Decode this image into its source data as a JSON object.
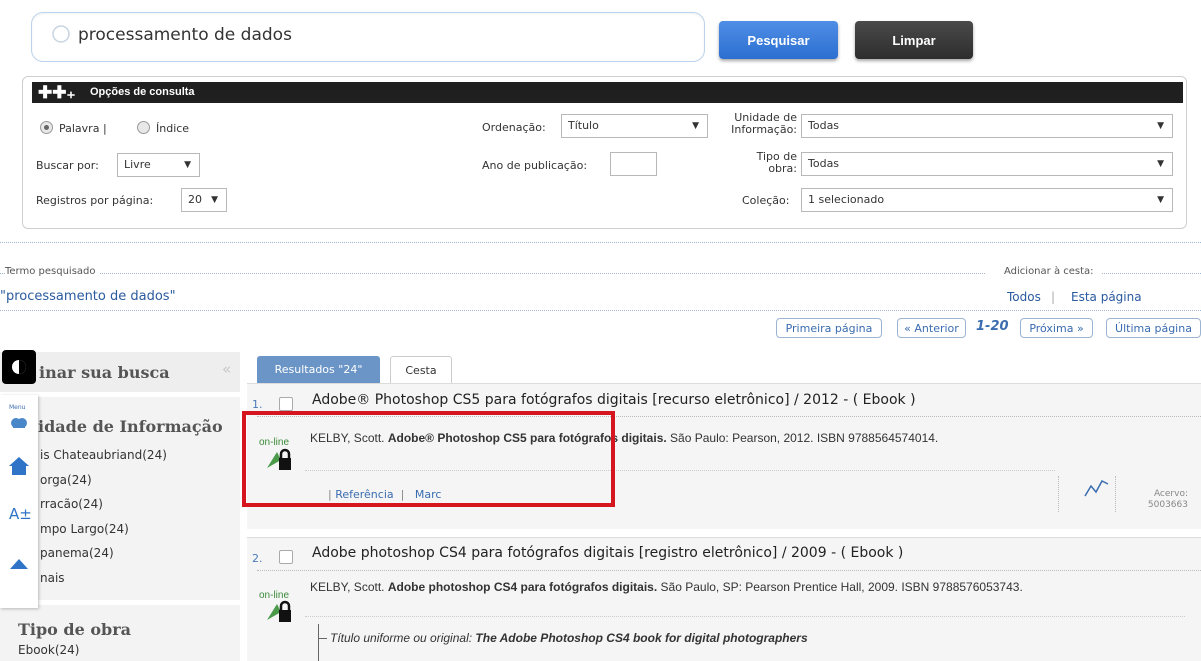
{
  "search": {
    "query": "processamento de dados",
    "search_label": "Pesquisar",
    "clear_label": "Limpar"
  },
  "options": {
    "header": "Opções de consulta",
    "radio_word": "Palavra |",
    "radio_index": "Índice",
    "search_by_label": "Buscar por:",
    "search_by_value": "Livre",
    "per_page_label": "Registros por página:",
    "per_page_value": "20",
    "order_label": "Ordenação:",
    "order_value": "Título",
    "year_label": "Ano de publicação:",
    "unit_label_1": "Unidade de",
    "unit_label_2": "Informação:",
    "unit_value": "Todas",
    "type_label_1": "Tipo de",
    "type_label_2": "obra:",
    "type_value": "Todas",
    "collection_label": "Coleção:",
    "collection_value": "1 selecionado"
  },
  "term": {
    "label": "Termo pesquisado",
    "value": "\"processamento de dados\""
  },
  "cart": {
    "label": "Adicionar à cesta:",
    "all": "Todos",
    "separator": "|",
    "page": "Esta página"
  },
  "pager": {
    "first": "Primeira página",
    "prev": "« Anterior",
    "range": "1-20",
    "next": "Próxima »",
    "last": "Última página"
  },
  "sidebar": {
    "title": "inar sua busca",
    "unit_title": "idade de Informação",
    "unit_items": [
      "is Chateaubriand(24)",
      "orga(24)",
      "rracão(24)",
      "mpo Largo(24)",
      "panema(24)",
      "nais"
    ],
    "type_title": "Tipo de obra",
    "type_items": [
      "Ebook(24)"
    ],
    "access_menu": "Menu"
  },
  "tabs": {
    "results": "Resultados \"24\"",
    "cart": "Cesta"
  },
  "results": [
    {
      "num": "1.",
      "title": "Adobe® Photoshop CS5 para fotógrafos digitais [recurso eletrônico] / 2012 - ( Ebook )",
      "author": "KELBY, Scott.",
      "bold_title": "Adobe® Photoshop CS5 para fotógrafos digitais.",
      "rest": "São Paulo: Pearson, 2012. ISBN 9788564574014.",
      "online": "on-line",
      "ref_link": "Referência",
      "link_sep": "|",
      "marc_link": "Marc",
      "acervo_label": "Acervo:",
      "acervo_value": "5003663"
    },
    {
      "num": "2.",
      "title": "Adobe photoshop CS4 para fotógrafos digitais [registro eletrônico] / 2009 - ( Ebook )",
      "author": "KELBY, Scott.",
      "bold_title": "Adobe photoshop CS4 para fotógrafos digitais.",
      "rest": "São Paulo, SP: Pearson Prentice Hall, 2009. ISBN 9788576053743.",
      "online": "on-line",
      "uniform_label": "Título uniforme ou original:",
      "uniform_value": "The Adobe Photoshop CS4 book for digital photographers"
    }
  ]
}
